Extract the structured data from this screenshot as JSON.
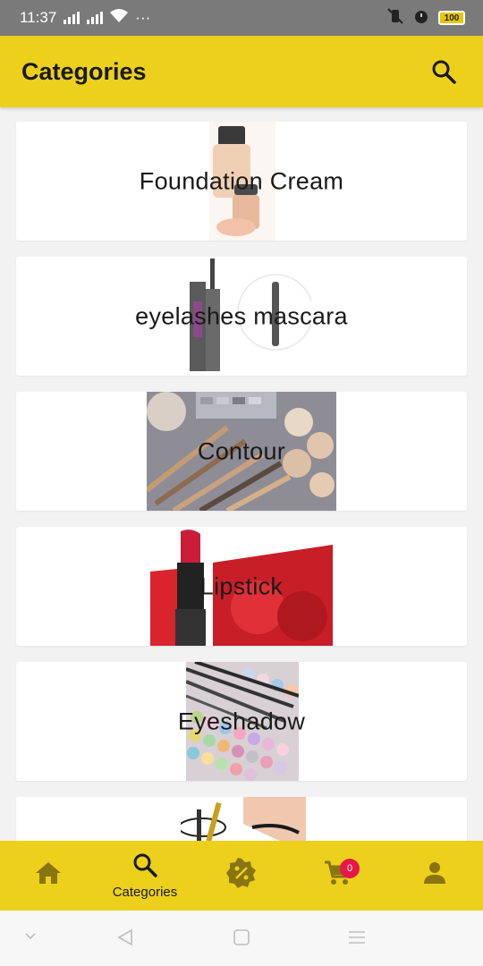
{
  "status_bar": {
    "time": "11:37",
    "dots": "···",
    "battery": "100"
  },
  "app_bar": {
    "title": "Categories",
    "search_icon": "search-icon"
  },
  "categories": [
    {
      "label": "Foundation Cream",
      "image": "foundation-bottle"
    },
    {
      "label": "eyelashes mascara",
      "image": "mascara-tube"
    },
    {
      "label": "Contour",
      "image": "makeup-palette-brushes"
    },
    {
      "label": "Lipstick",
      "image": "red-lipstick-roses"
    },
    {
      "label": "Eyeshadow",
      "image": "eyeshadow-palette"
    },
    {
      "label": "",
      "image": "eyeliner"
    }
  ],
  "bottom_nav": {
    "items": [
      {
        "icon": "home-icon",
        "label": ""
      },
      {
        "icon": "search-icon",
        "label": "Categories"
      },
      {
        "icon": "discount-badge-icon",
        "label": ""
      },
      {
        "icon": "cart-icon",
        "label": "",
        "badge": "0"
      },
      {
        "icon": "person-icon",
        "label": ""
      }
    ]
  },
  "colors": {
    "accent": "#ecd01c",
    "icon": "#8a7410",
    "badge": "#e8174a"
  }
}
